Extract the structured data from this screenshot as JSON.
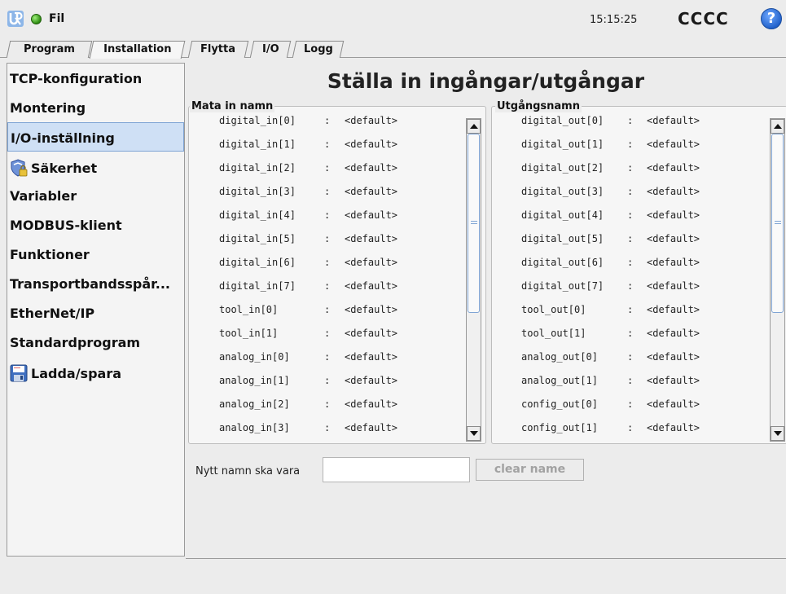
{
  "topbar": {
    "file_label": "Fil",
    "time": "15:15:25",
    "robot_name": "CCCC",
    "help_symbol": "?"
  },
  "tabs": [
    {
      "label": "Program",
      "active": false
    },
    {
      "label": "Installation",
      "active": true
    },
    {
      "label": "Flytta",
      "active": false
    },
    {
      "label": "I/O",
      "active": false
    },
    {
      "label": "Logg",
      "active": false
    }
  ],
  "sidebar": {
    "selected_index": 2,
    "items": [
      {
        "label": "TCP-konfiguration",
        "icon": null
      },
      {
        "label": "Montering",
        "icon": null
      },
      {
        "label": "I/O-inställning",
        "icon": null
      },
      {
        "label": "Säkerhet",
        "icon": "shield-lock-icon"
      },
      {
        "label": "Variabler",
        "icon": null
      },
      {
        "label": "MODBUS-klient",
        "icon": null
      },
      {
        "label": "Funktioner",
        "icon": null
      },
      {
        "label": "Transportbandsspår...",
        "icon": null
      },
      {
        "label": "EtherNet/IP",
        "icon": null
      },
      {
        "label": "Standardprogram",
        "icon": null
      },
      {
        "label": "Ladda/spara",
        "icon": "floppy-disk-icon"
      }
    ]
  },
  "main": {
    "title": "Ställa in ingångar/utgångar",
    "inputs": {
      "legend": "Mata in namn",
      "rows": [
        {
          "name": "digital_in[0]",
          "value": "<default>"
        },
        {
          "name": "digital_in[1]",
          "value": "<default>"
        },
        {
          "name": "digital_in[2]",
          "value": "<default>"
        },
        {
          "name": "digital_in[3]",
          "value": "<default>"
        },
        {
          "name": "digital_in[4]",
          "value": "<default>"
        },
        {
          "name": "digital_in[5]",
          "value": "<default>"
        },
        {
          "name": "digital_in[6]",
          "value": "<default>"
        },
        {
          "name": "digital_in[7]",
          "value": "<default>"
        },
        {
          "name": "tool_in[0]",
          "value": "<default>"
        },
        {
          "name": "tool_in[1]",
          "value": "<default>"
        },
        {
          "name": "analog_in[0]",
          "value": "<default>"
        },
        {
          "name": "analog_in[1]",
          "value": "<default>"
        },
        {
          "name": "analog_in[2]",
          "value": "<default>"
        },
        {
          "name": "analog_in[3]",
          "value": "<default>"
        }
      ]
    },
    "outputs": {
      "legend": "Utgångsnamn",
      "rows": [
        {
          "name": "digital_out[0]",
          "value": "<default>"
        },
        {
          "name": "digital_out[1]",
          "value": "<default>"
        },
        {
          "name": "digital_out[2]",
          "value": "<default>"
        },
        {
          "name": "digital_out[3]",
          "value": "<default>"
        },
        {
          "name": "digital_out[4]",
          "value": "<default>"
        },
        {
          "name": "digital_out[5]",
          "value": "<default>"
        },
        {
          "name": "digital_out[6]",
          "value": "<default>"
        },
        {
          "name": "digital_out[7]",
          "value": "<default>"
        },
        {
          "name": "tool_out[0]",
          "value": "<default>"
        },
        {
          "name": "tool_out[1]",
          "value": "<default>"
        },
        {
          "name": "analog_out[0]",
          "value": "<default>"
        },
        {
          "name": "analog_out[1]",
          "value": "<default>"
        },
        {
          "name": "config_out[0]",
          "value": "<default>"
        },
        {
          "name": "config_out[1]",
          "value": "<default>"
        }
      ]
    },
    "separator": ":",
    "new_name_label": "Nytt namn ska vara",
    "new_name_value": "",
    "clear_button_label": "clear name"
  },
  "colors": {
    "selection": "#cfe0f5",
    "run_indicator": "#2c8a10",
    "help_icon": "#1f5fc8",
    "disabled_text": "#a2a2a2"
  }
}
